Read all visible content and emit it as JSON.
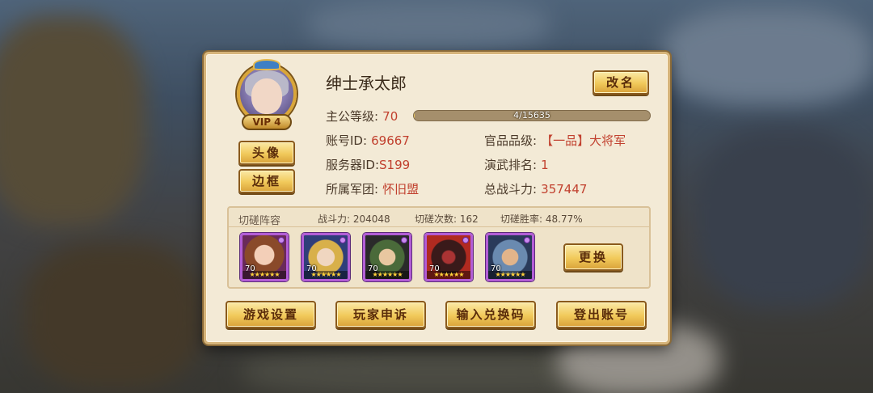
{
  "player": {
    "name": "绅士承太郎",
    "vip_label": "VIP 4"
  },
  "buttons": {
    "rename": "改名",
    "avatar": "头像",
    "frame": "边框",
    "change": "更换"
  },
  "stats": {
    "level_label": "主公等级:",
    "level_value": "70",
    "exp_text": "4/15635",
    "exp_progress": 0.0003,
    "account_label": "账号ID:",
    "account_value": "69667",
    "rank_label": "官品品级:",
    "rank_value": "【一品】大将军",
    "server_label": "服务器ID:",
    "server_value": "S199",
    "arena_label": "演武排名:",
    "arena_value": "1",
    "guild_label": "所属军团:",
    "guild_value": "怀旧盟",
    "power_label": "总战斗力:",
    "power_value": "357447"
  },
  "lineup": {
    "title": "切磋阵容",
    "power": "战斗力: 204048",
    "count": "切磋次数: 162",
    "winrate": "切磋胜率: 48.77%",
    "heroes": [
      {
        "level": "70",
        "stars": "★★★★★★"
      },
      {
        "level": "70",
        "stars": "★★★★★★"
      },
      {
        "level": "70",
        "stars": "★★★★★★"
      },
      {
        "level": "70",
        "stars": "★★★★★★"
      },
      {
        "level": "70",
        "stars": "★★★★★★"
      }
    ]
  },
  "bottom": {
    "settings": "游戏设置",
    "appeal": "玩家申诉",
    "redeem": "输入兑换码",
    "logout": "登出账号"
  }
}
